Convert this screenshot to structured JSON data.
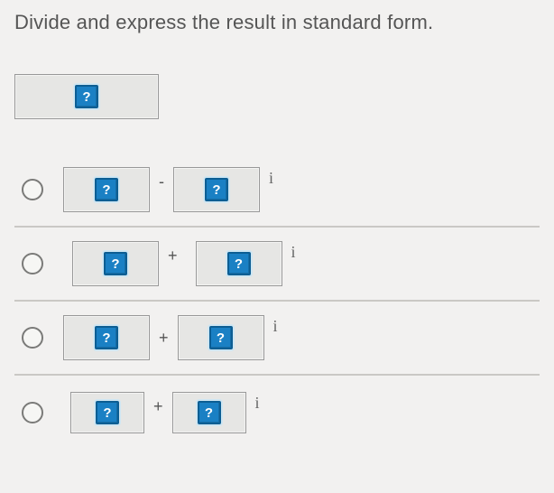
{
  "question": {
    "prompt": "Divide and express the result in standard form.",
    "placeholder_glyph": "?"
  },
  "options": [
    {
      "op": "-",
      "i_suffix": "i"
    },
    {
      "op": "+",
      "i_suffix": "i"
    },
    {
      "op": "+",
      "i_suffix": "i"
    },
    {
      "op": "+",
      "i_suffix": "i"
    }
  ]
}
